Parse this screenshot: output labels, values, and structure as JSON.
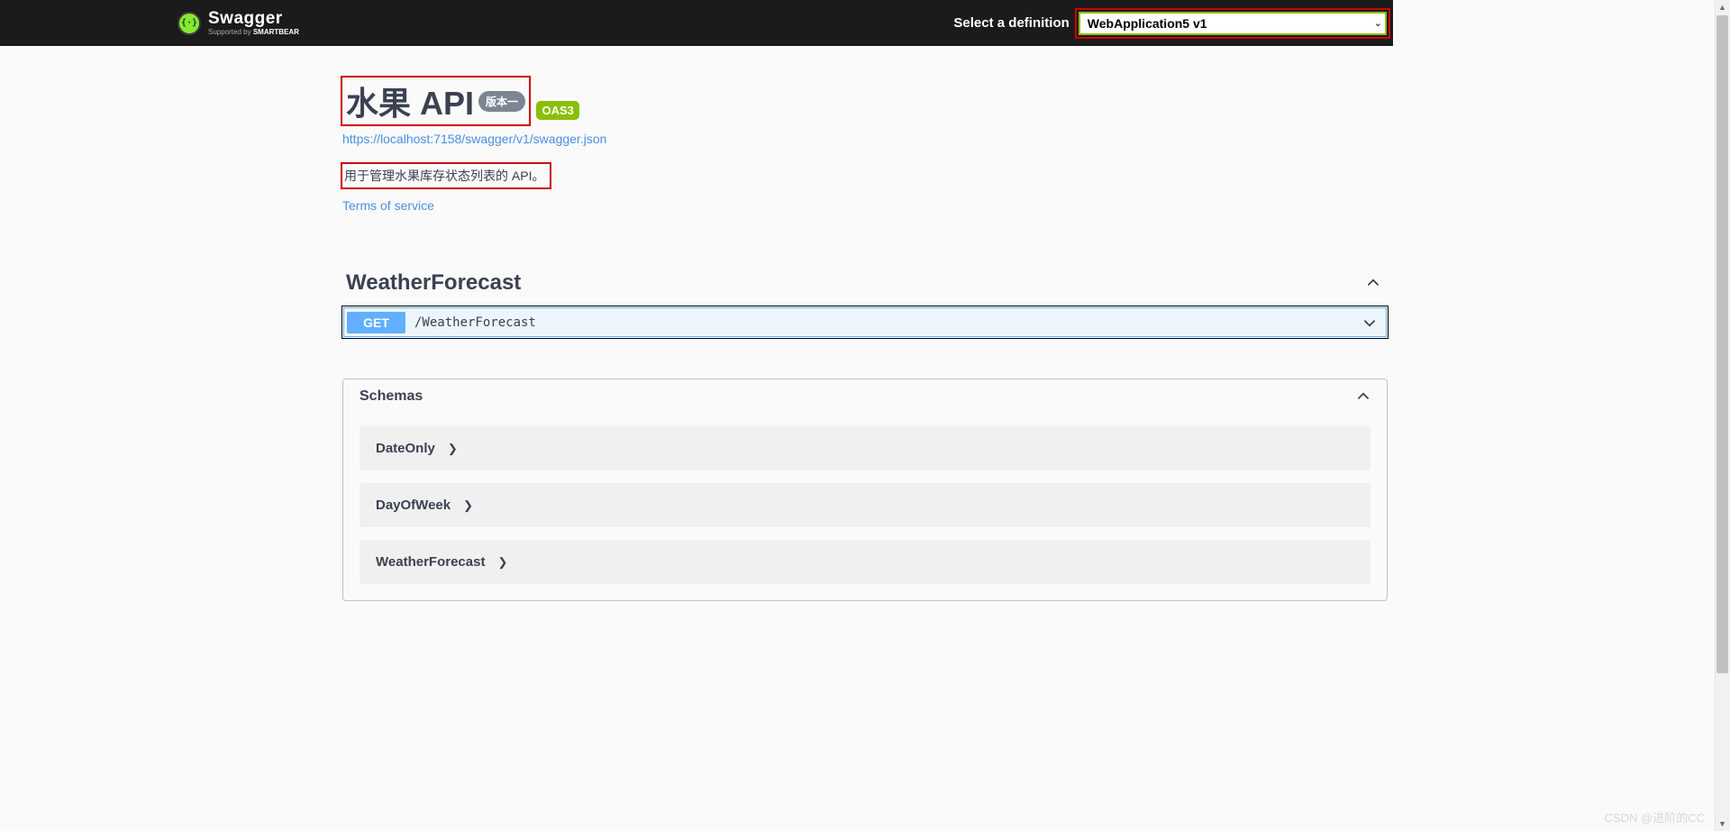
{
  "topbar": {
    "brand_name": "Swagger",
    "brand_sub_prefix": "Supported by ",
    "brand_sub_strong": "SMARTBEAR",
    "select_label": "Select a definition",
    "selected_def": "WebApplication5 v1"
  },
  "info": {
    "title": "水果 API",
    "version": "版本一",
    "oas": "OAS3",
    "spec_url": "https://localhost:7158/swagger/v1/swagger.json",
    "description": "用于管理水果库存状态列表的 API。",
    "tos": "Terms of service"
  },
  "tag": {
    "name": "WeatherForecast",
    "op_method": "GET",
    "op_path": "/WeatherForecast"
  },
  "schemas": {
    "title": "Schemas",
    "items": [
      "DateOnly",
      "DayOfWeek",
      "WeatherForecast"
    ]
  },
  "watermark": "CSDN @进阶的CC"
}
